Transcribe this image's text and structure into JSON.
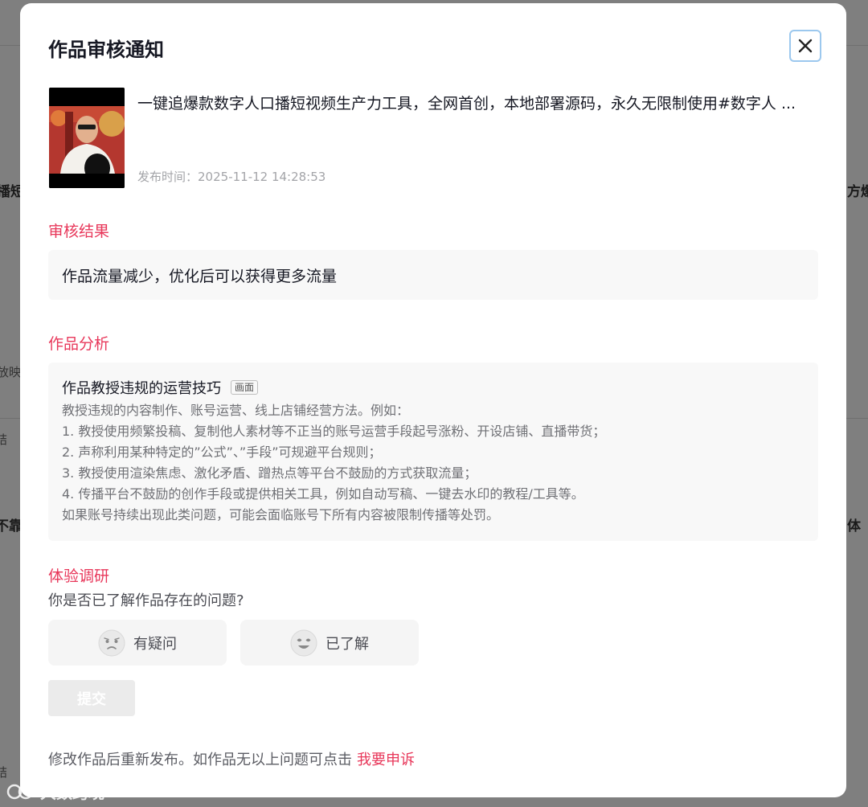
{
  "background": {
    "fragments": [
      "播短",
      "方爆",
      "放映",
      "结",
      "不靠",
      "体",
      "结"
    ]
  },
  "modal": {
    "title": "作品审核通知",
    "close_icon": "close-icon",
    "video": {
      "title": "一键追爆款数字人口播短视频生产力工具，全网首创，本地部署源码，永久无限制使用#数字人 ...",
      "publish_label": "发布时间：",
      "publish_time": "2025-11-12 14:28:53"
    },
    "result": {
      "heading": "审核结果",
      "text": "作品流量减少，优化后可以获得更多流量"
    },
    "analysis": {
      "heading": "作品分析",
      "title": "作品教授违规的运营技巧",
      "tag": "画面",
      "lines": [
        "教授违规的内容制作、账号运营、线上店铺经营方法。例如：",
        "1. 教授使用频繁投稿、复制他人素材等不正当的账号运营手段起号涨粉、开设店铺、直播带货；",
        "2. 声称利用某种特定的”公式”、”手段”可规避平台规则；",
        "3. 教授使用渲染焦虑、激化矛盾、蹭热点等平台不鼓励的方式获取流量；",
        "4. 传播平台不鼓励的创作手段或提供相关工具，例如自动写稿、一键去水印的教程/工具等。",
        "如果账号持续出现此类问题，可能会面临账号下所有内容被限制传播等处罚。"
      ]
    },
    "survey": {
      "heading": "体验调研",
      "question": "你是否已了解作品存在的问题?",
      "options": [
        {
          "label": "有疑问",
          "icon": "confused-face-icon"
        },
        {
          "label": "已了解",
          "icon": "happy-face-icon"
        }
      ],
      "submit_label": "提交"
    },
    "footer": {
      "text": "修改作品后重新发布。如作品无以上问题可点击",
      "appeal_link": "我要申诉"
    }
  },
  "watermark": {
    "text": "大数跨境",
    "icon": "logo-icon"
  },
  "colors": {
    "accent": "#e8375a",
    "overlay": "#7f7f7f",
    "panel": "#f8f8f8"
  }
}
